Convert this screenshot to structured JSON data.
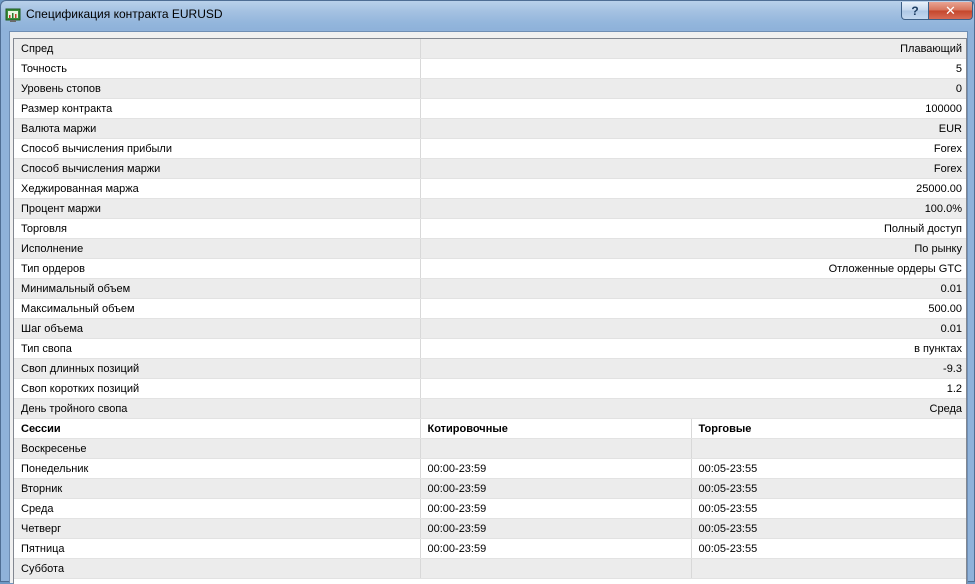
{
  "window": {
    "title": "Спецификация контракта EURUSD",
    "help_label": "?",
    "close_label": "✕"
  },
  "spec_rows": [
    {
      "label": "Спред",
      "value": "Плавающий"
    },
    {
      "label": "Точность",
      "value": "5"
    },
    {
      "label": "Уровень стопов",
      "value": "0"
    },
    {
      "label": "Размер контракта",
      "value": "100000"
    },
    {
      "label": "Валюта маржи",
      "value": "EUR"
    },
    {
      "label": "Способ вычисления прибыли",
      "value": "Forex"
    },
    {
      "label": "Способ вычисления маржи",
      "value": "Forex"
    },
    {
      "label": "Хеджированная маржа",
      "value": "25000.00"
    },
    {
      "label": "Процент маржи",
      "value": "100.0%"
    },
    {
      "label": "Торговля",
      "value": "Полный доступ"
    },
    {
      "label": "Исполнение",
      "value": "По рынку"
    },
    {
      "label": "Тип ордеров",
      "value": "Отложенные ордеры GTC"
    },
    {
      "label": "Минимальный объем",
      "value": "0.01"
    },
    {
      "label": "Максимальный объем",
      "value": "500.00"
    },
    {
      "label": "Шаг объема",
      "value": "0.01"
    },
    {
      "label": "Тип свопа",
      "value": "в пунктах"
    },
    {
      "label": "Своп длинных позиций",
      "value": "-9.3"
    },
    {
      "label": "Своп коротких позиций",
      "value": "1.2"
    },
    {
      "label": "День тройного свопа",
      "value": "Среда"
    }
  ],
  "sessions": {
    "headers": {
      "day": "Сессии",
      "quote": "Котировочные",
      "trade": "Торговые"
    },
    "rows": [
      {
        "day": "Воскресенье",
        "quote": "",
        "trade": ""
      },
      {
        "day": "Понедельник",
        "quote": "00:00-23:59",
        "trade": "00:05-23:55"
      },
      {
        "day": "Вторник",
        "quote": "00:00-23:59",
        "trade": "00:05-23:55"
      },
      {
        "day": "Среда",
        "quote": "00:00-23:59",
        "trade": "00:05-23:55"
      },
      {
        "day": "Четверг",
        "quote": "00:00-23:59",
        "trade": "00:05-23:55"
      },
      {
        "day": "Пятница",
        "quote": "00:00-23:59",
        "trade": "00:05-23:55"
      },
      {
        "day": "Суббота",
        "quote": "",
        "trade": ""
      }
    ]
  },
  "icons": {
    "app": "terminal-chart-icon"
  }
}
